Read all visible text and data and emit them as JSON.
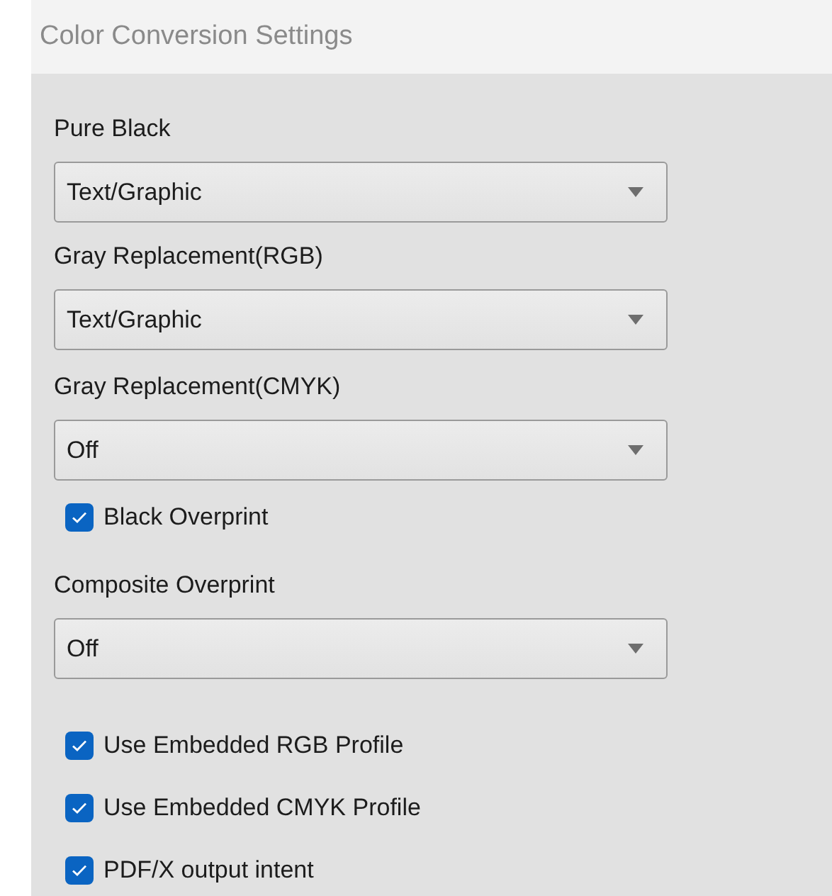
{
  "window": {
    "title": "Color Conversion Settings"
  },
  "groups": [
    {
      "items": [
        {
          "kind": "label",
          "text": "Pure Black"
        },
        {
          "kind": "select",
          "value": "Text/Graphic"
        }
      ]
    },
    {
      "items": [
        {
          "kind": "label",
          "text": "Gray Replacement(RGB)"
        },
        {
          "kind": "select",
          "value": "Text/Graphic"
        }
      ]
    },
    {
      "items": [
        {
          "kind": "label",
          "text": "Gray Replacement(CMYK)"
        },
        {
          "kind": "select",
          "value": "Off"
        },
        {
          "kind": "checkbox",
          "text": "Black Overprint",
          "checked": true
        }
      ]
    },
    {
      "items": [
        {
          "kind": "label",
          "text": "Composite Overprint"
        },
        {
          "kind": "select",
          "value": "Off"
        }
      ]
    },
    {
      "items": [
        {
          "kind": "checkbox",
          "text": "Use Embedded RGB Profile",
          "checked": true
        },
        {
          "kind": "checkbox",
          "text": "Use Embedded CMYK Profile",
          "checked": true
        },
        {
          "kind": "checkbox",
          "text": "PDF/X output intent",
          "checked": true
        }
      ]
    }
  ]
}
